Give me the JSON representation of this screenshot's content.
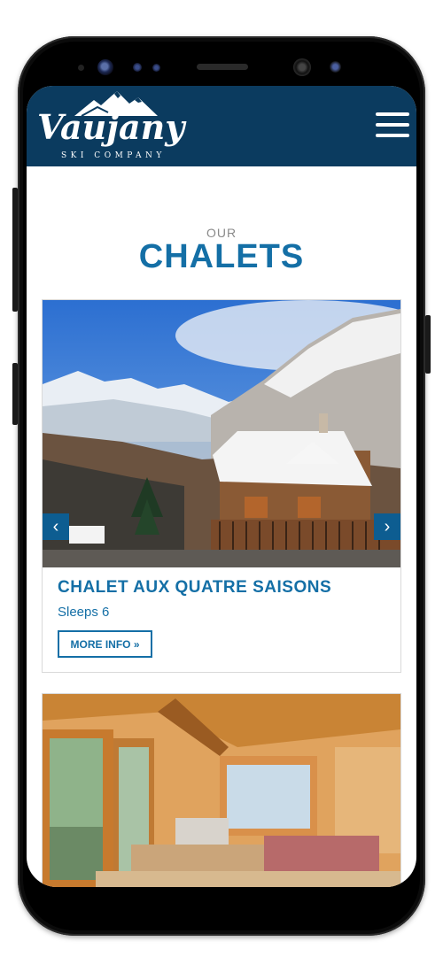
{
  "brand": {
    "name": "Vaujany",
    "tagline": "SKI COMPANY"
  },
  "colors": {
    "header_bg": "#0b3b5f",
    "accent": "#146fa6",
    "button_bg": "#0d5d91"
  },
  "section": {
    "eyebrow": "OUR",
    "title": "CHALETS"
  },
  "listings": [
    {
      "name": "CHALET AUX QUATRE SAISONS",
      "sleeps": "Sleeps 6",
      "cta": "MORE INFO »"
    }
  ],
  "carousel": {
    "prev_icon": "chevron-left-icon",
    "next_icon": "chevron-right-icon",
    "prev_glyph": "‹",
    "next_glyph": "›"
  },
  "icons": {
    "menu": "hamburger-menu-icon"
  }
}
